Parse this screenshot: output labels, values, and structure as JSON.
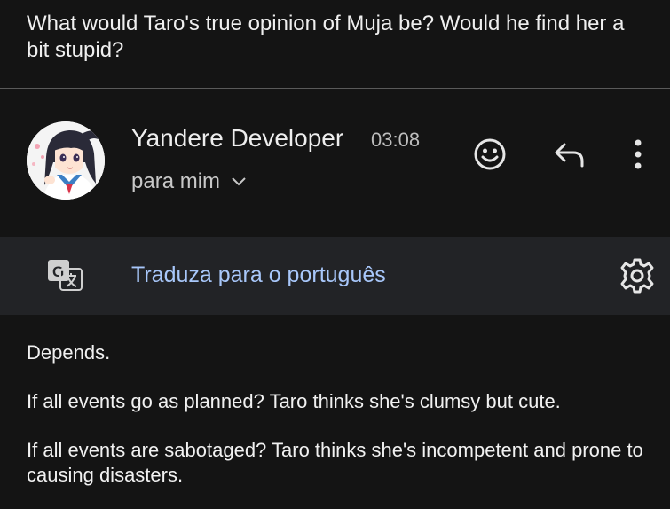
{
  "question": {
    "text": "What would Taro's true opinion of Muja be? Would he find her a bit stupid?"
  },
  "email": {
    "sender_name": "Yandere Developer",
    "time": "03:08",
    "recipient_label": "para mim",
    "avatar_icon": "anime-girl-avatar",
    "actions": {
      "emoji_icon": "emoji-smile-icon",
      "reply_icon": "reply-arrow-icon",
      "more_icon": "more-vertical-icon"
    }
  },
  "translate": {
    "link_text": "Traduza para o português",
    "translate_icon": "translate-icon",
    "settings_icon": "gear-icon",
    "link_color": "#a8c7fa"
  },
  "body": {
    "paragraphs": [
      "Depends.",
      "If all events go as planned? Taro thinks she's clumsy but cute.",
      "If all events are sabotaged? Taro thinks she's incompetent and prone to causing disasters."
    ]
  }
}
